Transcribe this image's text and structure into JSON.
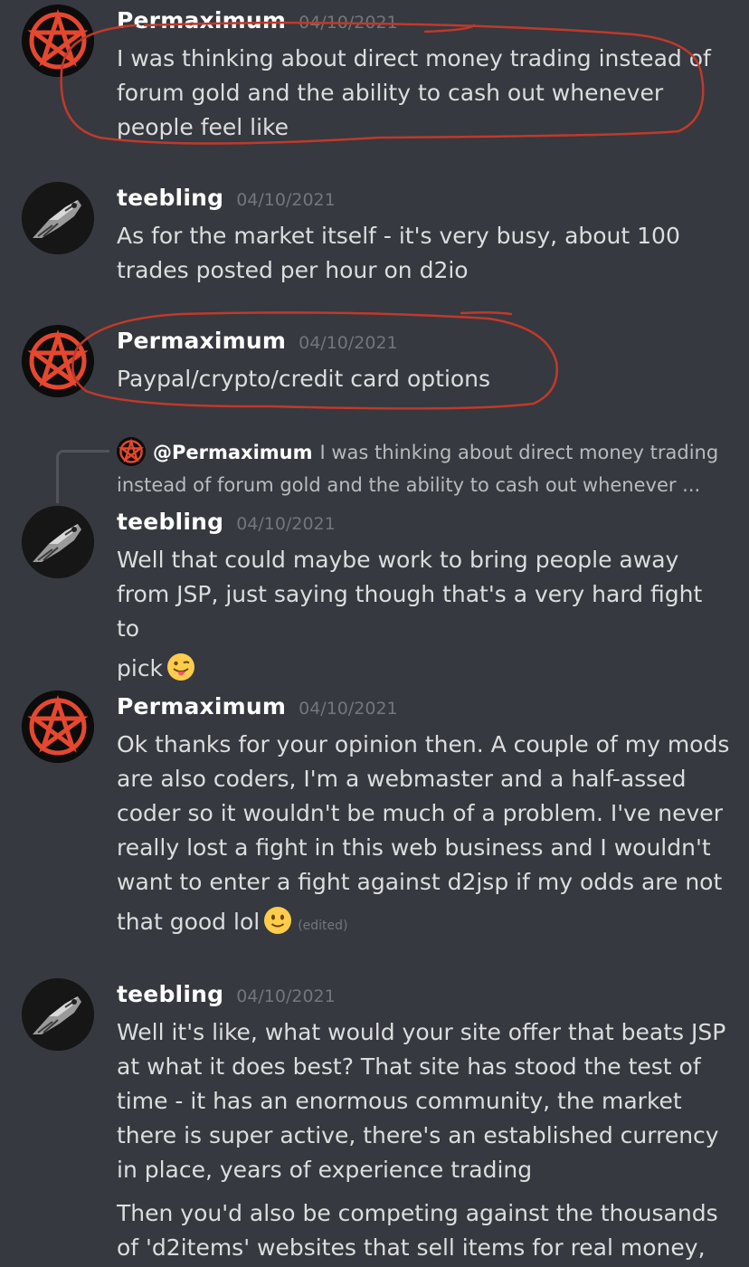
{
  "messages": [
    {
      "author": "Permaximum",
      "timestamp": "04/10/2021",
      "lines": [
        "I was thinking about direct money trading instead of",
        "forum gold and the ability to cash out whenever",
        "people feel like"
      ]
    },
    {
      "author": "teebling",
      "timestamp": "04/10/2021",
      "lines": [
        "As for the market itself - it's very busy, about 100",
        "trades posted per hour on d2io"
      ]
    },
    {
      "author": "Permaximum",
      "timestamp": "04/10/2021",
      "lines": [
        "Paypal/crypto/credit card options"
      ]
    },
    {
      "author": "teebling",
      "timestamp": "04/10/2021",
      "reply": {
        "mention": "@Permaximum",
        "text_line1": "I was thinking about direct money trading",
        "text_line2": "instead of forum gold and the ability to cash out whenever ..."
      },
      "lines": [
        "Well that could maybe work to bring people away",
        "from JSP, just saying though that's a very hard fight to",
        "pick"
      ],
      "emoji": "tongue-out-emoji"
    },
    {
      "author": "Permaximum",
      "timestamp": "04/10/2021",
      "lines": [
        "Ok thanks for your opinion then. A couple of my mods",
        "are also coders, I'm a webmaster and a half-assed",
        "coder so it wouldn't be much of a problem. I've never",
        "really lost a fight in this web business and I wouldn't",
        "want to enter a fight against d2jsp if my odds are not",
        "that good lol"
      ],
      "emoji": "slight-smile-emoji",
      "edited": "(edited)"
    },
    {
      "author": "teebling",
      "timestamp": "04/10/2021",
      "lines": [
        "Well it's like, what would your site offer that beats JSP",
        "at what it does best? That site has stood the test of",
        "time - it has an enormous community, the market",
        "there is super active, there's an established currency",
        "in place, years of experience trading"
      ],
      "lines2": [
        "Then you'd also be competing against the thousands",
        "of 'd2items' websites that sell items for real money,"
      ]
    }
  ],
  "colors": {
    "background": "#36393f",
    "text": "#dcddde",
    "timestamp": "#72767d",
    "annotation": "#c0392b",
    "pentagram": "#e74c3c"
  },
  "icons": {
    "permaximum_avatar": "pentagram-icon",
    "teebling_avatar": "crow-skull-icon"
  }
}
